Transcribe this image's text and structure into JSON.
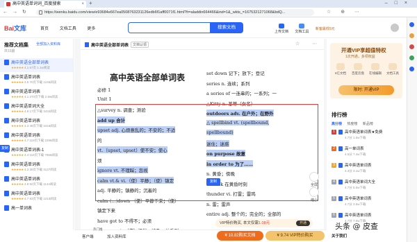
{
  "browser": {
    "tab_title": "高中英语单词词_百度搜索",
    "tab_close": "×",
    "new_tab": "+",
    "window_controls": "–□×",
    "nav_buttons": "←→↻",
    "url": "https://wenku.baidu.com/view/e93684e667ea0508763231126edb6f1aff0071f1.html?fr=aladdin664466&ind=1&_wkts_=1675321271068&bdQ...",
    "right_icons": "☆ ⊕ ⋯"
  },
  "header": {
    "logo": "Bai",
    "logo_suffix": "文库",
    "nav": [
      "首页",
      "文档工具",
      "更多"
    ],
    "search_button": "搜索文档",
    "actions": [
      "上传文档",
      "文档工具"
    ],
    "vip_badge": "新客最低5元"
  },
  "sidebar": {
    "title": "推荐文档集",
    "subtitle": "共15篇",
    "add_button": "全部加入资料库",
    "items": [
      {
        "title": "高中英语全部单词表",
        "stars": "★★★★★",
        "rating": "4.1",
        "pages": "67页",
        "downloads": "1.1w阅读",
        "active": true
      },
      {
        "title": "高中英语单词表",
        "stars": "★★★★★",
        "rating": "4.5",
        "pages": "70页下载",
        "downloads": "1246阅读",
        "active": false
      },
      {
        "title": "高中英语单词表",
        "stars": "★★★★★",
        "rating": "4.1",
        "pages": "270页下载",
        "downloads": "2.9w阅读",
        "active": false
      },
      {
        "title": "高中英语单词大全",
        "stars": "★★★★★",
        "rating": "4.8",
        "pages": "17页下载",
        "downloads": "3434阅读",
        "active": false
      },
      {
        "title": "高中英语单词表",
        "stars": "★★★★★",
        "rating": "4.3",
        "pages": "48页下载",
        "downloads": "3416阅读",
        "active": false
      },
      {
        "title": "高中英语单词表",
        "stars": "★★★★★",
        "rating": "4.7",
        "pages": "119页下载",
        "downloads": "2296阅读",
        "active": false
      },
      {
        "title": "高中英语单词表-1",
        "stars": "★★★★★",
        "rating": "4.4",
        "pages": "115页下载",
        "downloads": "7856阅读",
        "active": false
      },
      {
        "title": "高中英语单词表",
        "stars": "★★★★★",
        "rating": "4.3",
        "pages": "39页下载",
        "downloads": "3137阅读",
        "active": false
      },
      {
        "title": "高中英语单词表",
        "stars": "★★★★★",
        "rating": "4.8",
        "pages": "92页下载",
        "downloads": "1144阅读",
        "active": false
      },
      {
        "title": "高中英语单词表",
        "stars": "★★★★★",
        "rating": "4.7",
        "pages": "83页下载",
        "downloads": "1213阅读",
        "active": false
      },
      {
        "title": "高一单词表",
        "stars": "",
        "rating": "",
        "pages": "",
        "downloads": "",
        "active": false
      }
    ],
    "copy_tag": "复制"
  },
  "doc": {
    "title": "高中英语全部单词表",
    "badge": "文档认领",
    "top_icons": "☆ ⋯",
    "big_title": "高中英语全部单词表",
    "left_lines": [
      {
        "text": "必修 1",
        "hl": false,
        "bold": false
      },
      {
        "text": "Unit 1",
        "hl": false,
        "bold": false
      },
      {
        "text": "△survey  n.  调查；测验",
        "hl": false,
        "bold": false
      },
      {
        "text": "add up 合计",
        "hl": true,
        "bold": true
      },
      {
        "text": "upset adj. 心烦意乱的；不安的；不适",
        "hl": true,
        "bold": false
      },
      {
        "text": "的",
        "hl": false,
        "bold": false
      },
      {
        "text": "vt.（upset, upset）使不安；使心",
        "hl": true,
        "bold": false
      },
      {
        "text": "烦",
        "hl": false,
        "bold": false
      },
      {
        "text": "ignore vt. 不理睬；忽视",
        "hl": true,
        "bold": false
      },
      {
        "text": "calm vt.& vi.（使）平静；（使）镇定",
        "hl": true,
        "bold": false
      },
      {
        "text": "adj. 平静的；镇静的；沉着的",
        "hl": false,
        "bold": false
      },
      {
        "text": "calm (…)down （使）平静下来；（使）",
        "hl": false,
        "bold": false
      },
      {
        "text": "镇定下来",
        "hl": false,
        "bold": false
      },
      {
        "text": "have got to 不得不；必须",
        "hl": false,
        "bold": false
      },
      {
        "text": "concern vt. （使）担忧；涉及；关系到",
        "hl": false,
        "bold": false
      }
    ],
    "right_lines": [
      {
        "text": "set down 记下；放下；登记",
        "hl": false,
        "bold": false
      },
      {
        "text": "series n. 连续；系列",
        "hl": false,
        "bold": false
      },
      {
        "text": "a series of 一连串的；一系列；一",
        "hl": false,
        "bold": false
      },
      {
        "text": "△Kitty n. 基蒂（女名）",
        "hl": false,
        "bold": false
      },
      {
        "text": "outdoors adv. 在户外；在野外",
        "hl": true,
        "bold": true
      },
      {
        "text": "△ spellbind   vt.   (spellbound,",
        "hl": true,
        "bold": false
      },
      {
        "text": "spellbound)",
        "hl": true,
        "bold": false
      },
      {
        "text": "迷住；迷惑",
        "hl": true,
        "bold": false
      },
      {
        "text": "on purpose 故意",
        "hl": true,
        "bold": true
      },
      {
        "text": "in order to 为了……",
        "hl": true,
        "bold": true
      },
      {
        "text": "n. 黄昏；傍晚",
        "hl": false,
        "bold": false
      },
      {
        "text": "at dusk 在黄昏时刻",
        "hl": false,
        "bold": false
      },
      {
        "text": "thunder vi. 打雷；雷鸣",
        "hl": false,
        "bold": false
      },
      {
        "text": "n. 雷；雷声",
        "hl": false,
        "bold": false
      },
      {
        "text": "entire adj. 整个的；完全的；全部的",
        "hl": false,
        "bold": false
      }
    ],
    "copy_tag": "复制",
    "fullscreen": "全屏",
    "shrink": "缩小"
  },
  "bottom": {
    "client": "客户端",
    "add_lib": "加入资料库",
    "shopping_tag": "热门推",
    "vip_bar_text": "VIP特价购买, 本文仅需",
    "vip_bar_price": "1.08元",
    "vip_bar_button": "开通",
    "buy_button": "¥ 10.82购买文档",
    "vip_button": "¥ 9.74 VIP特价购买"
  },
  "right": {
    "vip_title": "开通VIP享超值特权",
    "vip_sub": "1次开通，多项权益",
    "features": [
      "6亿文档",
      "百度云盘",
      "在线编辑",
      "文档工具"
    ],
    "vip_cta": "限时: 开通VIP",
    "rank_title": "排行榜",
    "rank_tabs": [
      "高分榜",
      "热度榜",
      "新品榜"
    ],
    "rank_items": [
      {
        "n": "1",
        "title": "高中英语单词表★免费",
        "meta": "4.7分  1.5w下载"
      },
      {
        "n": "2",
        "title": "高一单词表",
        "meta": "4.5分  7.4w下载"
      },
      {
        "n": "3",
        "title": "高中英语单词表",
        "meta": "4.3分  3.1w下载"
      },
      {
        "n": "4",
        "title": "高中英语单词大全",
        "meta": "4.7分  5.5w下载"
      },
      {
        "n": "5",
        "title": "高中英语单词表",
        "meta": "4.7分  3.5w下载"
      },
      {
        "n": "6",
        "title": "高中英语单词表",
        "meta": "4.7分  7.0w下载"
      }
    ],
    "about": "关于我们"
  },
  "watermark": "头条 @ 皮查",
  "colors": {
    "accent": "#2a64f6",
    "selection": "#e53935",
    "vip": "#f06c1d"
  }
}
